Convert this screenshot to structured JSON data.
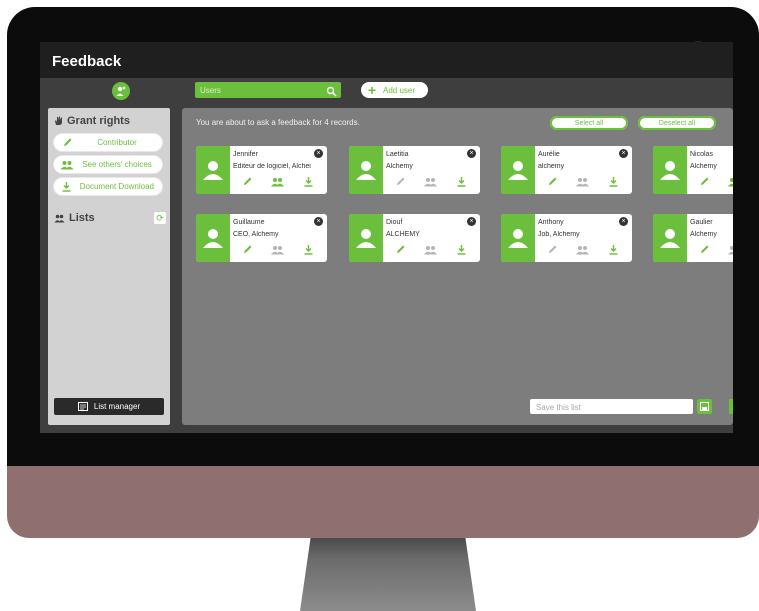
{
  "window": {
    "title": "Feedback"
  },
  "search": {
    "placeholder": "Users",
    "icon": "search-icon"
  },
  "toolbar": {
    "add_user_label": "Add user"
  },
  "sidebar": {
    "grant_rights_label": "Grant rights",
    "rights": [
      {
        "label": "Contributor",
        "icon": "pencil-icon"
      },
      {
        "label": "See others' choices",
        "icon": "users-icon"
      },
      {
        "label": "Document Download",
        "icon": "download-icon"
      }
    ],
    "lists_label": "Lists",
    "list_manager_label": "List manager"
  },
  "main": {
    "info_text": "You are about to ask a feedback for 4 records.",
    "select_all_label": "Select all",
    "deselect_all_label": "Deselect all",
    "save_placeholder": "Save this list"
  },
  "cards": [
    {
      "name": "Jennifer",
      "subtitle": "Editeur de logiciel, Alchei",
      "rights": [
        true,
        true,
        true
      ]
    },
    {
      "name": "Laetitia",
      "subtitle": "Alchemy",
      "rights": [
        false,
        false,
        true
      ]
    },
    {
      "name": "Aurélie",
      "subtitle": "alchemy",
      "rights": [
        true,
        false,
        true
      ]
    },
    {
      "name": "Nicolas",
      "subtitle": "Alchemy",
      "rights": [
        true,
        true,
        false
      ]
    },
    {
      "name": "Guillaume",
      "subtitle": "CEO, Alchemy",
      "rights": [
        true,
        false,
        true
      ]
    },
    {
      "name": "Diouf",
      "subtitle": "ALCHEMY",
      "rights": [
        true,
        false,
        true
      ]
    },
    {
      "name": "Anthony",
      "subtitle": "Job, Alchemy",
      "rights": [
        false,
        false,
        true
      ]
    },
    {
      "name": "Gaulier",
      "subtitle": "Alchemy",
      "rights": [
        true,
        false,
        false
      ]
    }
  ],
  "colors": {
    "accent": "#6cbf3d",
    "inactive_icon": "#b5b5b5",
    "panel": "#7d7d7d",
    "monitor_chin": "#8f6f6f"
  }
}
